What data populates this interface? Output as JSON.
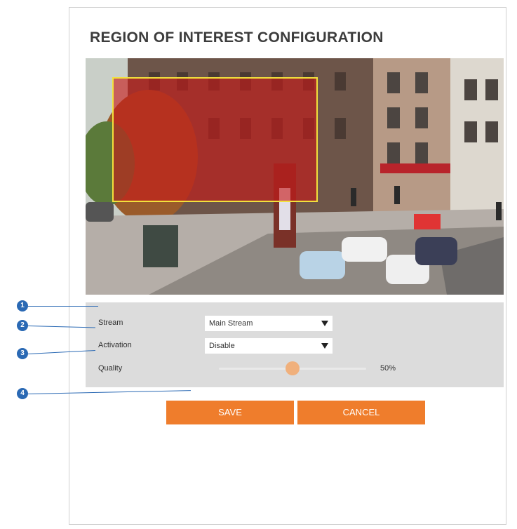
{
  "page": {
    "title": "REGION OF INTEREST CONFIGURATION"
  },
  "settings": {
    "stream": {
      "label": "Stream",
      "value": "Main Stream"
    },
    "activation": {
      "label": "Activation",
      "value": "Disable"
    },
    "quality": {
      "label": "Quality",
      "value": 50,
      "value_text": "50%"
    }
  },
  "buttons": {
    "save": "SAVE",
    "cancel": "CANCEL"
  },
  "markers": [
    "1",
    "2",
    "3",
    "4"
  ],
  "colors": {
    "accent": "#ef7d2c",
    "roi_fill": "#c81919",
    "roi_border": "#f2e13c",
    "marker": "#2a69b4",
    "settings_bg": "#dcdcdc"
  }
}
